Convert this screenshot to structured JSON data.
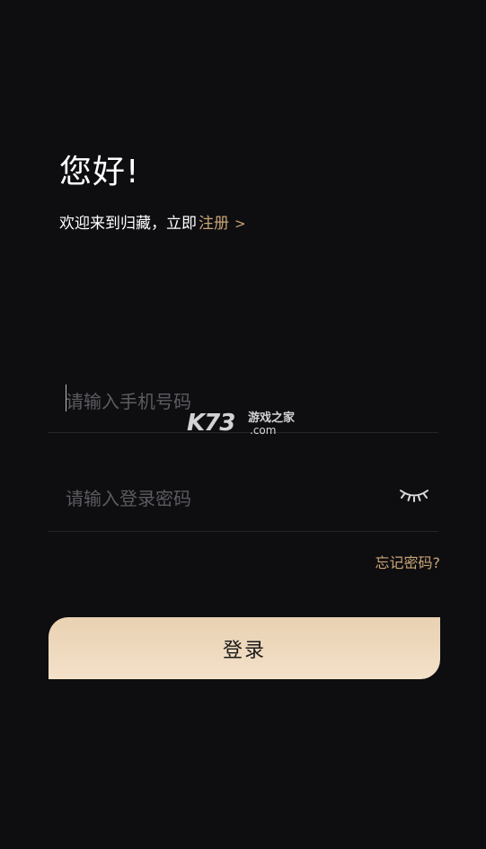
{
  "header": {
    "greeting": "您好!",
    "welcome": "欢迎来到归藏，立即",
    "register_label": "注册",
    "register_chevron": ">"
  },
  "form": {
    "phone_placeholder": "请输入手机号码",
    "phone_value": "",
    "password_placeholder": "请输入登录密码",
    "password_value": "",
    "password_toggle_icon": "eye-closed-icon",
    "forgot_label": "忘记密码?",
    "login_label": "登录"
  },
  "watermark": {
    "logo": "K73",
    "tagline": "游戏之家",
    "domain": ".com"
  },
  "colors": {
    "background": "#0e0d10",
    "accent": "#c9a676",
    "button_top": "#e9d1b2",
    "button_bottom": "#f3e1c9"
  }
}
